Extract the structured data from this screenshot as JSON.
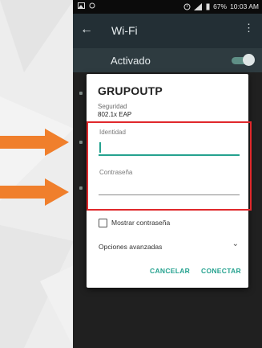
{
  "status_bar": {
    "battery": "67%",
    "time": "10:03 AM"
  },
  "app_bar": {
    "back": "←",
    "title": "Wi-Fi",
    "menu": "⋮"
  },
  "wifi_toggle": {
    "label": "Activado",
    "state": "on"
  },
  "dialog": {
    "title": "GRUPOUTP",
    "security_label": "Seguridad",
    "security_value": "802.1x EAP",
    "identity_label": "Identidad",
    "identity_value": "",
    "password_label": "Contraseña",
    "password_value": "",
    "show_password_label": "Mostrar contraseña",
    "show_password_checked": false,
    "advanced_label": "Opciones avanzadas",
    "advanced_chevron": "⌄",
    "cancel_label": "CANCELAR",
    "connect_label": "CONECTAR"
  },
  "colors": {
    "accent": "#25a28f",
    "highlight": "#e0282c",
    "arrow": "#f07f2c",
    "app_bar": "#232f35"
  },
  "icons": [
    "image-icon",
    "notification-icon",
    "alarm-icon",
    "signal-icon",
    "battery-icon"
  ]
}
